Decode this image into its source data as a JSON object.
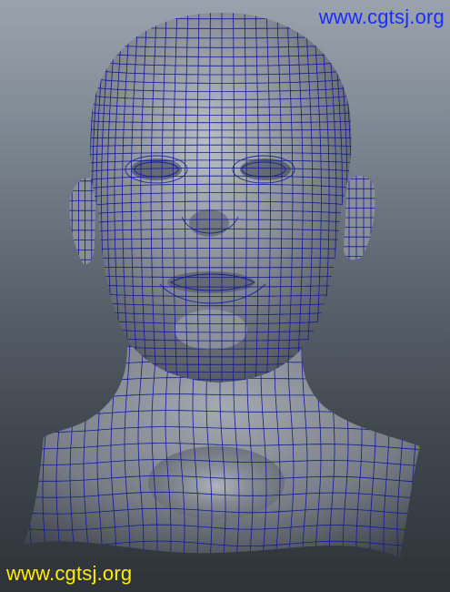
{
  "watermarks": {
    "top": "www.cgtsj.org",
    "bottom": "www.cgtsj.org"
  },
  "colors": {
    "watermark_top": "#1a2cff",
    "watermark_bottom": "#ffee00",
    "wireframe": "#101a9a",
    "surface": "#8b8f97",
    "background_top": "#9aa3ad",
    "background_bottom": "#2e3339"
  }
}
